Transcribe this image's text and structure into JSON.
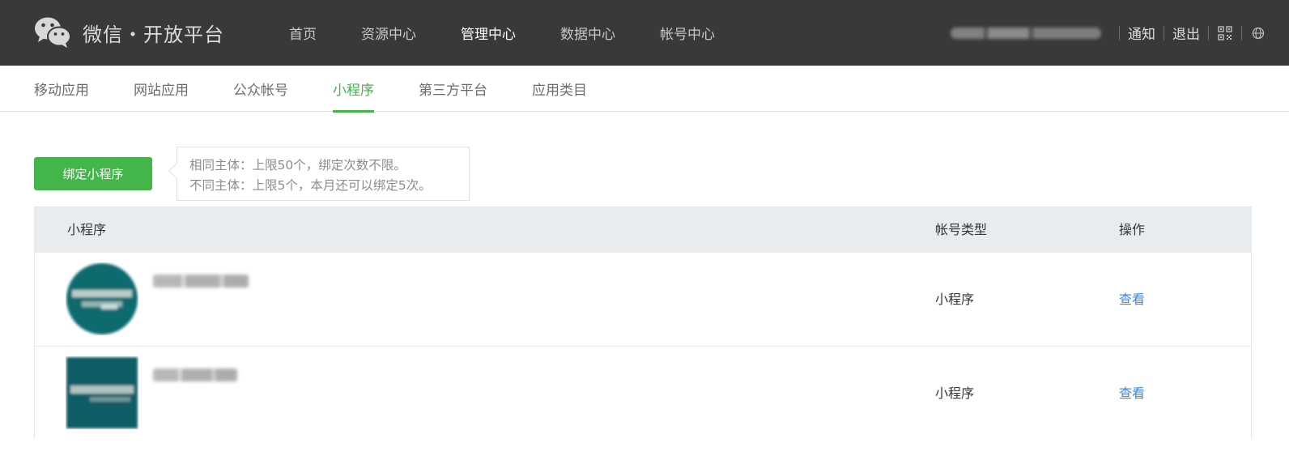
{
  "brand": {
    "title": "微信・开放平台",
    "logo_icon": "wechat-logo-icon"
  },
  "topnav": {
    "items": [
      {
        "label": "首页",
        "active": false
      },
      {
        "label": "资源中心",
        "active": false
      },
      {
        "label": "管理中心",
        "active": true
      },
      {
        "label": "数据中心",
        "active": false
      },
      {
        "label": "帐号中心",
        "active": false
      }
    ]
  },
  "userbar": {
    "username": "",
    "notify_label": "通知",
    "logout_label": "退出",
    "qrcode_icon": "qrcode-icon",
    "globe_icon": "globe-icon"
  },
  "subnav": {
    "items": [
      {
        "label": "移动应用",
        "active": false
      },
      {
        "label": "网站应用",
        "active": false
      },
      {
        "label": "公众帐号",
        "active": false
      },
      {
        "label": "小程序",
        "active": true
      },
      {
        "label": "第三方平台",
        "active": false
      },
      {
        "label": "应用类目",
        "active": false
      }
    ]
  },
  "bind": {
    "button_label": "绑定小程序",
    "tip_line1": "相同主体：上限50个，绑定次数不限。",
    "tip_line2": "不同主体：上限5个，本月还可以绑定5次。"
  },
  "table": {
    "columns": [
      "小程序",
      "帐号类型",
      "操作"
    ],
    "rows": [
      {
        "name": "",
        "avatar_shape": "circle",
        "type": "小程序",
        "action": "查看"
      },
      {
        "name": "",
        "avatar_shape": "square",
        "type": "小程序",
        "action": "查看"
      }
    ]
  },
  "colors": {
    "topbar_bg": "#393939",
    "accent_green": "#44b549",
    "link_blue": "#3d87d8",
    "table_header_bg": "#e9ecee",
    "avatar_teal": "#0f6b6e"
  }
}
